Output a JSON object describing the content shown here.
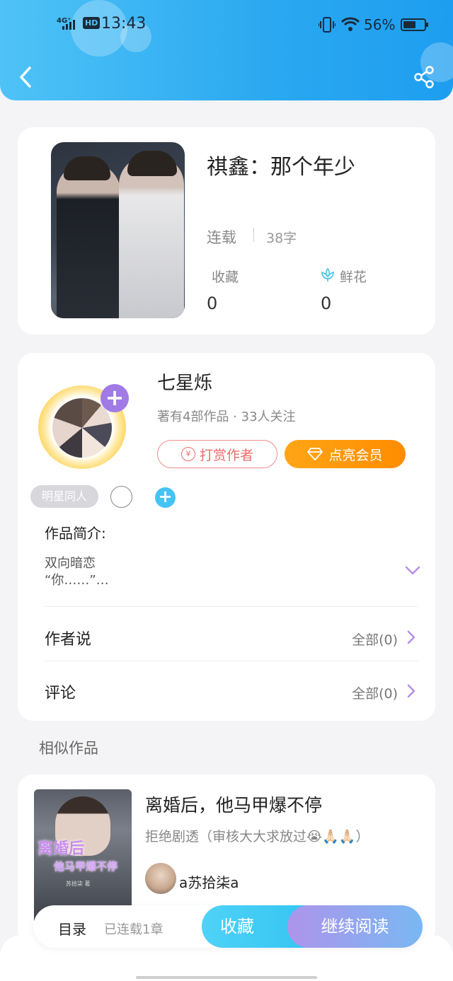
{
  "status_bar": {
    "signal": "4G⁺",
    "hd": "HD",
    "time": "13:43",
    "battery": "56%"
  },
  "book": {
    "title": "祺鑫：那个年少",
    "status": "连载",
    "words": "38字",
    "collect_label": "收藏",
    "collect_count": "0",
    "flower_label": "鲜花",
    "flower_count": "0"
  },
  "author": {
    "name": "七星烁",
    "meta": "著有4部作品 · 33人关注",
    "tip_label": "打赏作者",
    "tip_icon_text": "¥",
    "vip_label": "点亮会员",
    "tag": "明星同人"
  },
  "intro": {
    "title": "作品简介:",
    "line1": "双向暗恋",
    "line2": "“你……”…"
  },
  "rows": {
    "author_says": "作者说",
    "author_says_right": "全部(0)",
    "comments": "评论",
    "comments_right": "全部(0)"
  },
  "similar": {
    "heading": "相似作品",
    "item": {
      "title": "离婚后，他马甲爆不停",
      "desc": "拒绝剧透（审核大大求放过😭🙏🏻🙏🏻）",
      "author": "a苏拾柒a",
      "cover_text_1": "离婚后",
      "cover_text_2": "他马甲爆不停",
      "cover_text_3": "苏拾柒 著"
    }
  },
  "bottom_bar": {
    "toc": "目录",
    "toc_sub": "已连载1章",
    "collect": "收藏",
    "continue": "继续阅读"
  },
  "colors": {
    "header_gradient_start": "#4fc3f7",
    "accent_blue": "#36c5f2",
    "accent_purple": "#a07be6",
    "vip_orange": "#ff9a0a",
    "tip_red": "#ee6b6b"
  }
}
